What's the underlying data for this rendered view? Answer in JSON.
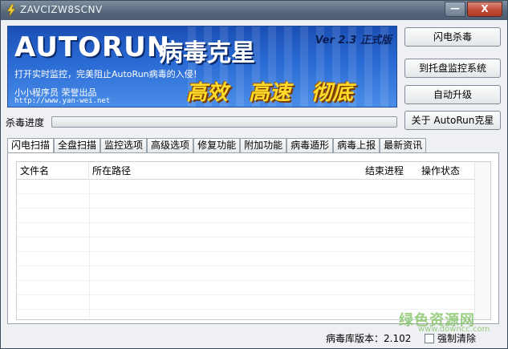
{
  "window": {
    "title": "ZAVCIZW8SCNV",
    "close_label": "X",
    "min_label": "—"
  },
  "banner": {
    "logo_text": "AUTORUN",
    "logo_cn": "病毒克星",
    "version": "Ver 2.3 正式版",
    "slogan": "打开实时监控，完美阻止AutoRun病毒的入侵！",
    "author": "小小程序员 荣誉出品",
    "url": "http://www.yan-wei.net",
    "features": [
      "高效",
      "高速",
      "彻底"
    ]
  },
  "side_buttons": {
    "flash_kill": "闪电杀毒",
    "tray_monitor": "到托盘监控系统",
    "auto_update": "自动升级",
    "about": "关于 AutoRun克星"
  },
  "progress": {
    "label": "杀毒进度",
    "value": 0
  },
  "tabs": [
    {
      "label": "闪电扫描",
      "active": true
    },
    {
      "label": "全盘扫描"
    },
    {
      "label": "监控选项"
    },
    {
      "label": "高级选项"
    },
    {
      "label": "修复功能"
    },
    {
      "label": "附加功能"
    },
    {
      "label": "病毒遁形"
    },
    {
      "label": "病毒上报"
    },
    {
      "label": "最新资讯"
    }
  ],
  "table": {
    "columns": [
      "文件名",
      "所在路径",
      "结束进程",
      "操作状态"
    ]
  },
  "status": {
    "db_version": "病毒库版本：2.102",
    "force_clean": "强制清除"
  },
  "watermark": {
    "text": "绿色资源网",
    "url": "www.downcc.com"
  }
}
